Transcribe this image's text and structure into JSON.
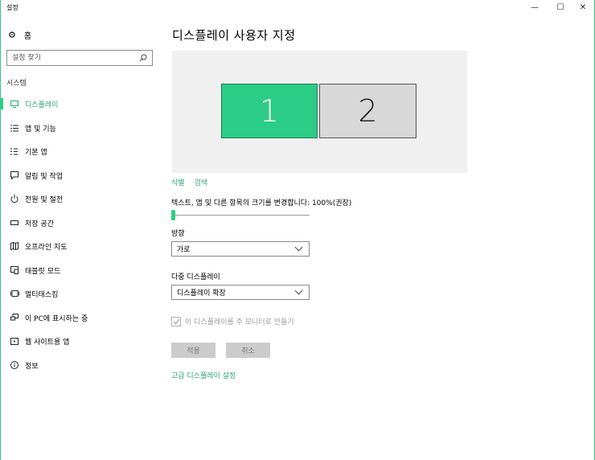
{
  "window": {
    "title": "설정",
    "minimize": "—",
    "maximize": "☐",
    "close": "✕"
  },
  "sidebar": {
    "home_label": "홈",
    "search_placeholder": "설정 찾기",
    "section": "시스템",
    "items": [
      {
        "label": "디스플레이",
        "icon": "monitor-icon",
        "active": true
      },
      {
        "label": "앱 및 기능",
        "icon": "apps-list-icon",
        "active": false
      },
      {
        "label": "기본 앱",
        "icon": "default-apps-icon",
        "active": false
      },
      {
        "label": "알림 및 작업",
        "icon": "notification-icon",
        "active": false
      },
      {
        "label": "전원 및 절전",
        "icon": "power-icon",
        "active": false
      },
      {
        "label": "저장 공간",
        "icon": "storage-icon",
        "active": false
      },
      {
        "label": "오프라인 지도",
        "icon": "map-icon",
        "active": false
      },
      {
        "label": "태블릿 모드",
        "icon": "tablet-icon",
        "active": false
      },
      {
        "label": "멀티태스킹",
        "icon": "multitasking-icon",
        "active": false
      },
      {
        "label": "이 PC에 표시하는 중",
        "icon": "projecting-icon",
        "active": false
      },
      {
        "label": "웹 사이트용 앱",
        "icon": "web-apps-icon",
        "active": false
      },
      {
        "label": "정보",
        "icon": "info-icon",
        "active": false
      }
    ]
  },
  "main": {
    "title": "디스플레이 사용자 지정",
    "monitors": [
      "1",
      "2"
    ],
    "identify_link": "식별",
    "detect_link": "검색",
    "scale_label": "텍스트, 앱 및 다른 항목의 크기를 변경합니다: 100%(권장)",
    "scale_value_percent": 100,
    "orientation_label": "방향",
    "orientation_value": "가로",
    "multi_display_label": "다중 디스플레이",
    "multi_display_value": "디스플레이 확장",
    "main_display_checkbox": "이 디스플레이를 주 모니터로 만들기",
    "main_display_checked": true,
    "apply_button": "적용",
    "cancel_button": "취소",
    "advanced_link": "고급 디스플레이 설정"
  },
  "colors": {
    "accent": "#2ccd86",
    "link": "#2aa772",
    "preview_bg": "#f0f0f0",
    "monitor2": "#d8d8d8",
    "disabled_button": "#cccccc"
  }
}
